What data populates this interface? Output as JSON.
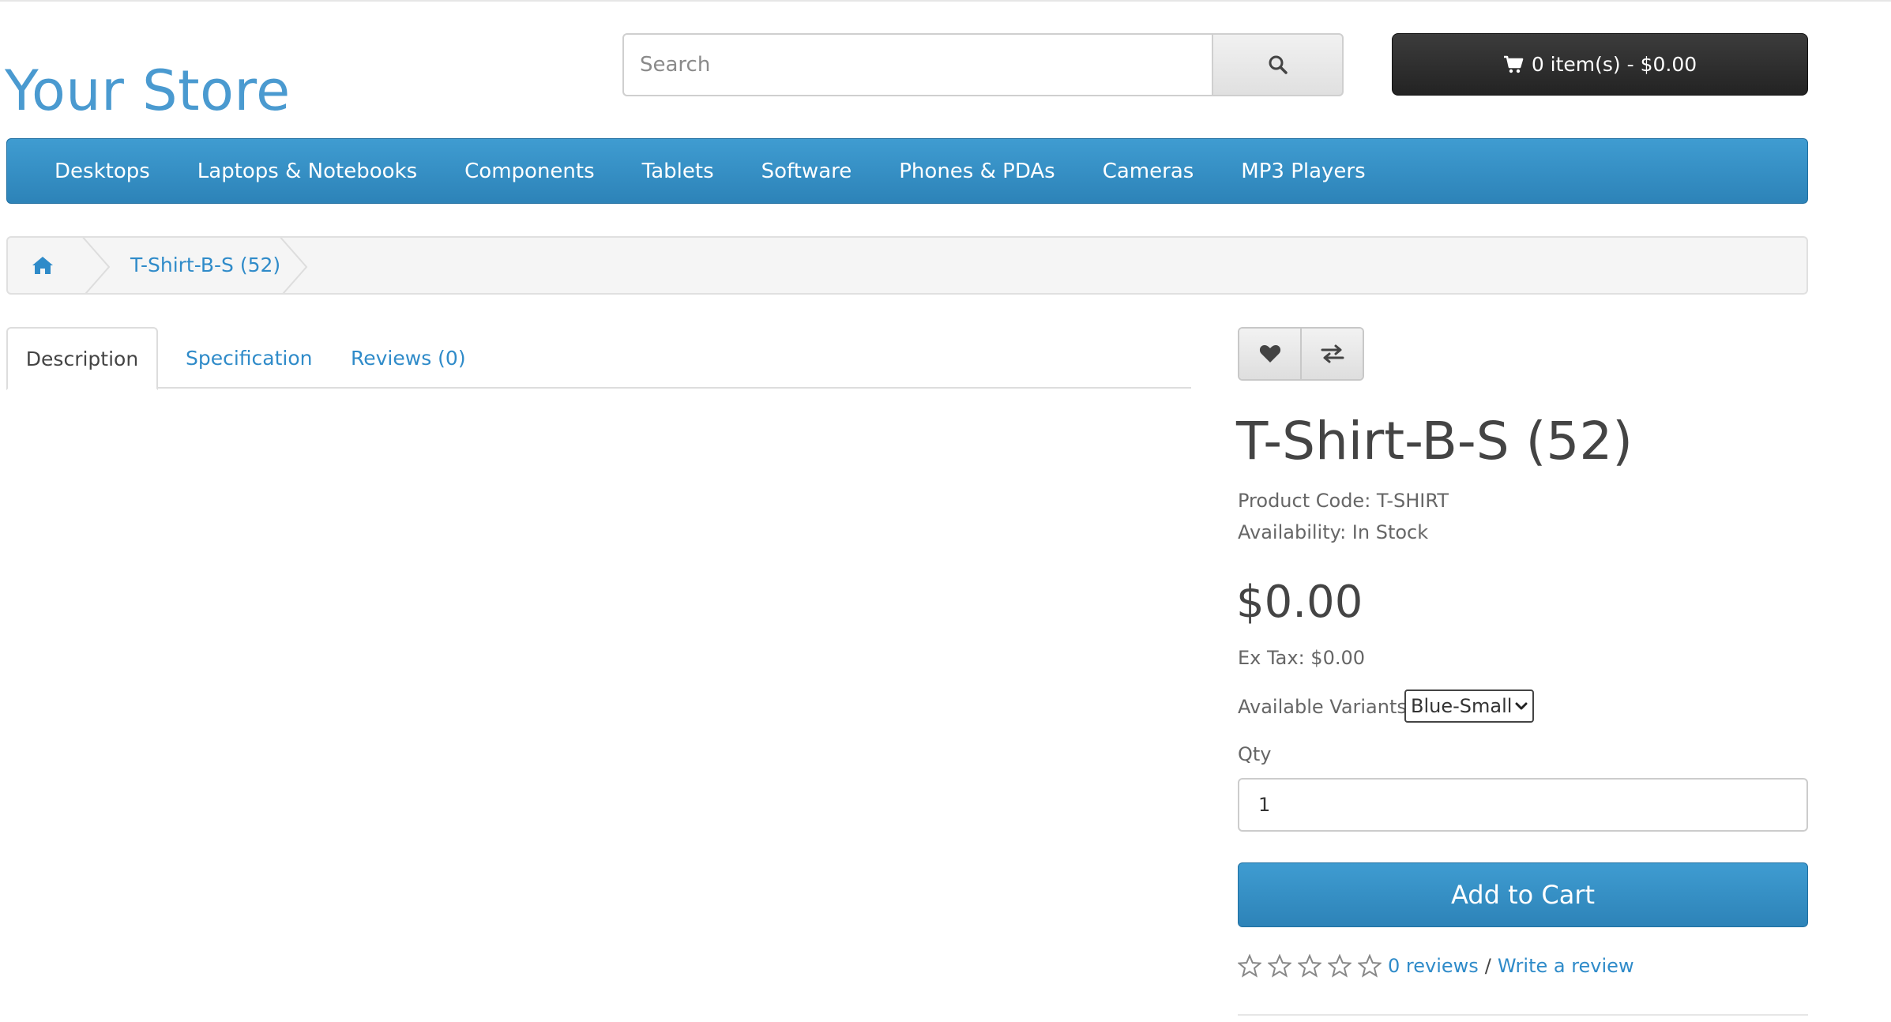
{
  "store": {
    "name": "Your Store"
  },
  "search": {
    "placeholder": "Search"
  },
  "cart": {
    "label": "0 item(s) - $0.00"
  },
  "nav": {
    "items": [
      "Desktops",
      "Laptops & Notebooks",
      "Components",
      "Tablets",
      "Software",
      "Phones & PDAs",
      "Cameras",
      "MP3 Players"
    ]
  },
  "breadcrumb": {
    "current": "T-Shirt-B-S (52)"
  },
  "tabs": [
    "Description",
    "Specification",
    "Reviews (0)"
  ],
  "product": {
    "title": "T-Shirt-B-S (52)",
    "code_label": "Product Code: T-SHIRT",
    "availability_label": "Availability: In Stock",
    "price": "$0.00",
    "ex_tax": "Ex Tax: $0.00",
    "variants_label": "Available Variants:",
    "variant_selected": "Blue-Small",
    "qty_label": "Qty",
    "qty_value": "1",
    "add_to_cart": "Add to Cart",
    "rating": 0,
    "rating_max": 5,
    "reviews_link": "0 reviews",
    "write_review": "Write a review"
  },
  "colors": {
    "accent": "#2f8bc9",
    "nav_bg": "#3a94cc",
    "cart_bg": "#2b2b2b"
  },
  "icons": {
    "search": "search-icon",
    "cart": "shopping-cart-icon",
    "home": "home-icon",
    "wishlist": "heart-icon",
    "compare": "exchange-icon",
    "star": "star-outline-icon"
  }
}
